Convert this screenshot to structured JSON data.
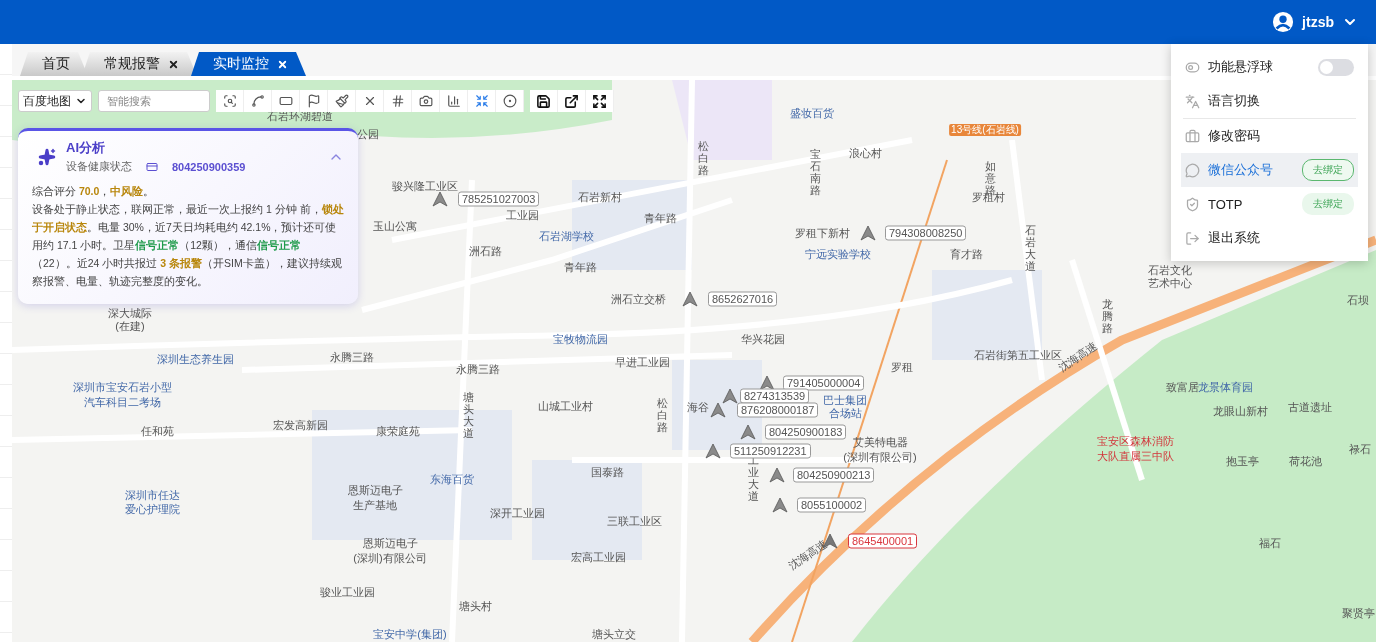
{
  "header": {
    "user": "jtzsb"
  },
  "tabs": [
    {
      "label": "首页",
      "closable": false,
      "selected": false
    },
    {
      "label": "常规报警",
      "closable": true,
      "selected": false
    },
    {
      "label": "实时监控",
      "closable": true,
      "selected": true
    }
  ],
  "toolbar": {
    "map_type": "百度地图",
    "search": {
      "placeholder": "智能搜索"
    },
    "tools": [
      {
        "kind": "zoom-box",
        "active": false
      },
      {
        "kind": "polyline",
        "active": false
      },
      {
        "kind": "rect",
        "active": false
      },
      {
        "kind": "flag",
        "active": false
      },
      {
        "kind": "brush",
        "active": false
      },
      {
        "kind": "clear",
        "active": false
      },
      {
        "kind": "traffic",
        "active": false
      },
      {
        "kind": "camera",
        "active": false
      },
      {
        "kind": "chart",
        "active": false
      },
      {
        "kind": "cluster",
        "active": true
      },
      {
        "kind": "locate",
        "active": false
      }
    ],
    "actions": [
      {
        "kind": "save"
      },
      {
        "kind": "open"
      },
      {
        "kind": "fullscreen"
      }
    ]
  },
  "ai_panel": {
    "title": "AI分析",
    "subtitle": "设备健康状态",
    "device": "804250900359",
    "expanded": true,
    "paragraphs": [
      [
        {
          "text": "综合评分 "
        },
        {
          "text": "70.0",
          "color": "#b8860b"
        },
        {
          "text": "，"
        },
        {
          "text": "中风险",
          "color": "#b8860b"
        },
        {
          "text": "。"
        }
      ],
      [
        {
          "text": "设备处于静止状态，联网正常，最近一次上报约 1 分钟 前，"
        },
        {
          "text": "锁处于开启状态",
          "color": "#b8860b"
        },
        {
          "text": "。电量 30%，近7天日均耗电约 42.1%，预计还可使用约 17.1 小时。卫星"
        },
        {
          "text": "信号正常",
          "color": "#1d9a4a"
        },
        {
          "text": "（12颗），通信"
        },
        {
          "text": "信号正常",
          "color": "#1d9a4a"
        },
        {
          "text": "（22）。近24 小时共报过 "
        },
        {
          "text": "3 条报警",
          "color": "#b8860b"
        },
        {
          "text": "（开SIM卡盖），建议持续观察报警、电量、轨迹完整度的变化。"
        }
      ]
    ]
  },
  "user_menu": {
    "items": [
      {
        "kind": "toggle",
        "label": "功能悬浮球",
        "on": false,
        "highlighted": false
      },
      {
        "kind": "plain",
        "label": "语言切换",
        "highlighted": false
      },
      {
        "kind": "plain",
        "label": "修改密码",
        "highlighted": false
      },
      {
        "kind": "bind",
        "label": "微信公众号",
        "badge": "去绑定",
        "highlighted": true
      },
      {
        "kind": "bind",
        "label": "TOTP",
        "badge": "去绑定",
        "highlighted": false
      },
      {
        "kind": "plain",
        "label": "退出系统",
        "highlighted": false
      }
    ]
  },
  "map": {
    "road_names": [
      "松白路",
      "宝石南路",
      "如意路",
      "石岩大道",
      "龙腾路",
      "塘头大道",
      "松白路",
      "工业大道"
    ],
    "places": [
      {
        "name": "石岩环湖碧道",
        "kind": "place"
      },
      {
        "name": "盛妆百货",
        "kind": "poi"
      },
      {
        "name": "公园",
        "kind": "place"
      },
      {
        "name": "13号线(石岩线)",
        "kind": "metro"
      },
      {
        "name": "浪心村",
        "kind": "place"
      },
      {
        "name": "骏兴隆工业区",
        "kind": "place"
      },
      {
        "name": "石岩新村",
        "kind": "place"
      },
      {
        "name": "罗租村",
        "kind": "place"
      },
      {
        "name": "玉山公寓",
        "kind": "place"
      },
      {
        "name": "工业园",
        "kind": "place"
      },
      {
        "name": "青年路",
        "kind": "road"
      },
      {
        "name": "石岩湖学校",
        "kind": "poi"
      },
      {
        "name": "罗租下新村",
        "kind": "place"
      },
      {
        "name": "洲石路",
        "kind": "road"
      },
      {
        "name": "宁远实验学校",
        "kind": "poi"
      },
      {
        "name": "育才路",
        "kind": "road"
      },
      {
        "name": "青年路",
        "kind": "road"
      },
      {
        "name": "石岩文化",
        "kind": "place"
      },
      {
        "name": "艺术中心",
        "kind": "place"
      },
      {
        "name": "洲石立交桥",
        "kind": "place"
      },
      {
        "name": "石坝",
        "kind": "place"
      },
      {
        "name": "深大城际",
        "kind": "place"
      },
      {
        "name": "(在建)",
        "kind": "place"
      },
      {
        "name": "宝牧物流园",
        "kind": "poi"
      },
      {
        "name": "华兴花园",
        "kind": "place"
      },
      {
        "name": "深圳生态养生园",
        "kind": "poi"
      },
      {
        "name": "永腾三路",
        "kind": "road"
      },
      {
        "name": "永腾三路",
        "kind": "road"
      },
      {
        "name": "早进工业园",
        "kind": "place"
      },
      {
        "name": "罗租",
        "kind": "place"
      },
      {
        "name": "石岩街第五工业区",
        "kind": "place"
      },
      {
        "name": "沈海高速",
        "kind": "highway"
      },
      {
        "name": "深圳市宝安石岩小型",
        "kind": "poi"
      },
      {
        "name": "致富居",
        "kind": "place"
      },
      {
        "name": "龙景体育园",
        "kind": "poi"
      },
      {
        "name": "汽车科目二考场",
        "kind": "poi"
      },
      {
        "name": "山城工业村",
        "kind": "place"
      },
      {
        "name": "海谷",
        "kind": "place"
      },
      {
        "name": "巴士集团",
        "kind": "poi"
      },
      {
        "name": "合场站",
        "kind": "poi"
      },
      {
        "name": "龙眼山新村",
        "kind": "place"
      },
      {
        "name": "古道遗址",
        "kind": "place"
      },
      {
        "name": "任和苑",
        "kind": "place"
      },
      {
        "name": "宏发高新园",
        "kind": "place"
      },
      {
        "name": "康荣庭苑",
        "kind": "place"
      },
      {
        "name": "艾美特电器",
        "kind": "place"
      },
      {
        "name": "(深圳有限公司)",
        "kind": "place"
      },
      {
        "name": "宝安区森林消防",
        "kind": "alert"
      },
      {
        "name": "大队直属三中队",
        "kind": "alert"
      },
      {
        "name": "抱玉亭",
        "kind": "place"
      },
      {
        "name": "荷花池",
        "kind": "place"
      },
      {
        "name": "禄石",
        "kind": "place"
      },
      {
        "name": "东海百货",
        "kind": "poi"
      },
      {
        "name": "国泰路",
        "kind": "road"
      },
      {
        "name": "深圳市任达",
        "kind": "poi"
      },
      {
        "name": "恩斯迈电子",
        "kind": "place"
      },
      {
        "name": "爱心护理院",
        "kind": "poi"
      },
      {
        "name": "生产基地",
        "kind": "place"
      },
      {
        "name": "深开工业园",
        "kind": "place"
      },
      {
        "name": "三联工业区",
        "kind": "place"
      },
      {
        "name": "恩斯迈电子",
        "kind": "place"
      },
      {
        "name": "(深圳)有限公司",
        "kind": "place"
      },
      {
        "name": "宏高工业园",
        "kind": "place"
      },
      {
        "name": "沈海高速",
        "kind": "highway"
      },
      {
        "name": "福石",
        "kind": "place"
      },
      {
        "name": "骏业工业园",
        "kind": "place"
      },
      {
        "name": "塘头村",
        "kind": "place"
      },
      {
        "name": "聚贤亭",
        "kind": "place"
      },
      {
        "name": "宝安中学(集团)",
        "kind": "poi"
      },
      {
        "name": "塘头立交",
        "kind": "place"
      }
    ],
    "devices": [
      {
        "id": "785251027003",
        "alarm": false
      },
      {
        "id": "794308008250",
        "alarm": false
      },
      {
        "id": "8652627016",
        "alarm": false
      },
      {
        "id": "791405000004",
        "alarm": false
      },
      {
        "id": "8274313539",
        "alarm": false
      },
      {
        "id": "876208000187",
        "alarm": false
      },
      {
        "id": "804250900183",
        "alarm": false
      },
      {
        "id": "511250912231",
        "alarm": false
      },
      {
        "id": "804250900213",
        "alarm": false
      },
      {
        "id": "8055100002",
        "alarm": false
      },
      {
        "id": "8645400001",
        "alarm": true
      }
    ]
  }
}
